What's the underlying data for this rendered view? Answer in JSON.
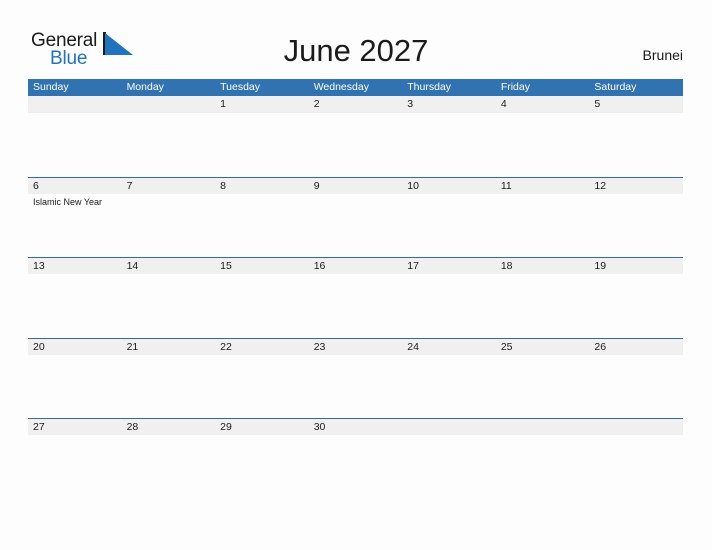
{
  "brand": {
    "name_part1": "General",
    "name_part2": "Blue",
    "flag_icon": "triangle-flag-icon",
    "color_black": "#1b1b1b",
    "color_blue": "#1f74bd"
  },
  "header": {
    "title": "June 2027",
    "country": "Brunei"
  },
  "colors": {
    "header_bar": "#3172b0",
    "date_band": "#f0f0f0",
    "row_rule": "#2e6da4",
    "page_background": "#fdfdfd",
    "text": "#1b1b1b"
  },
  "calendar": {
    "month": "June",
    "year": "2027",
    "day_headers": [
      "Sunday",
      "Monday",
      "Tuesday",
      "Wednesday",
      "Thursday",
      "Friday",
      "Saturday"
    ],
    "weeks": [
      {
        "days": [
          {
            "date": "",
            "events": []
          },
          {
            "date": "",
            "events": []
          },
          {
            "date": "1",
            "events": []
          },
          {
            "date": "2",
            "events": []
          },
          {
            "date": "3",
            "events": []
          },
          {
            "date": "4",
            "events": []
          },
          {
            "date": "5",
            "events": []
          }
        ]
      },
      {
        "days": [
          {
            "date": "6",
            "events": [
              "Islamic New Year"
            ]
          },
          {
            "date": "7",
            "events": []
          },
          {
            "date": "8",
            "events": []
          },
          {
            "date": "9",
            "events": []
          },
          {
            "date": "10",
            "events": []
          },
          {
            "date": "11",
            "events": []
          },
          {
            "date": "12",
            "events": []
          }
        ]
      },
      {
        "days": [
          {
            "date": "13",
            "events": []
          },
          {
            "date": "14",
            "events": []
          },
          {
            "date": "15",
            "events": []
          },
          {
            "date": "16",
            "events": []
          },
          {
            "date": "17",
            "events": []
          },
          {
            "date": "18",
            "events": []
          },
          {
            "date": "19",
            "events": []
          }
        ]
      },
      {
        "days": [
          {
            "date": "20",
            "events": []
          },
          {
            "date": "21",
            "events": []
          },
          {
            "date": "22",
            "events": []
          },
          {
            "date": "23",
            "events": []
          },
          {
            "date": "24",
            "events": []
          },
          {
            "date": "25",
            "events": []
          },
          {
            "date": "26",
            "events": []
          }
        ]
      },
      {
        "days": [
          {
            "date": "27",
            "events": []
          },
          {
            "date": "28",
            "events": []
          },
          {
            "date": "29",
            "events": []
          },
          {
            "date": "30",
            "events": []
          },
          {
            "date": "",
            "events": []
          },
          {
            "date": "",
            "events": []
          },
          {
            "date": "",
            "events": []
          }
        ]
      }
    ]
  }
}
